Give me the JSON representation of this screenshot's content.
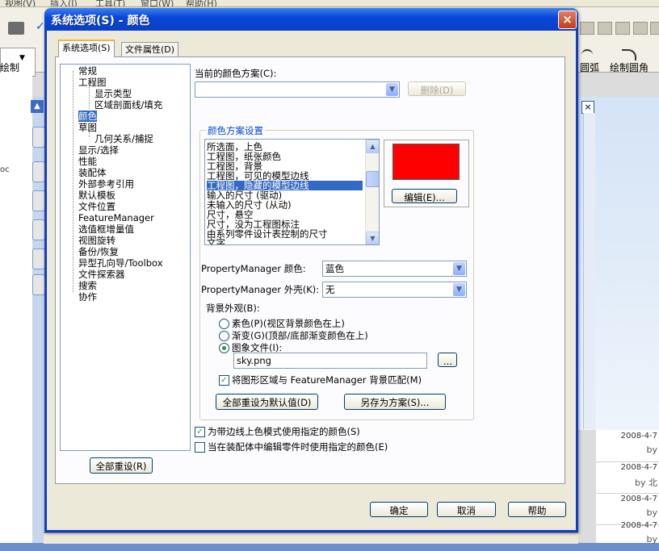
{
  "app": {
    "menu": [
      "视图(V)",
      "插入(I)",
      "工具(T)",
      "窗口(W)",
      "帮助(H)"
    ],
    "toolbar": {
      "draw_label": "绘制",
      "arc_label": "圆弧",
      "fillet_label": "绘制圆角"
    },
    "left_panel_label": "oc",
    "viewport_close": "×",
    "news": [
      {
        "date": "2008-4-7",
        "by": "by"
      },
      {
        "date": "2008-4-7",
        "by": "by 北"
      },
      {
        "date": "2008-4-7",
        "by": "by"
      },
      {
        "date": "2008-4-7",
        "by": "by"
      }
    ]
  },
  "dialog": {
    "title": "系统选项(S) - 颜色",
    "close_label": "×",
    "tabs": [
      {
        "label": "系统选项(S)",
        "active": true
      },
      {
        "label": "文件属性(D)",
        "active": false
      }
    ],
    "tree": {
      "items": [
        {
          "label": "常规",
          "level": 0,
          "selected": false
        },
        {
          "label": "工程图",
          "level": 0,
          "selected": false
        },
        {
          "label": "显示类型",
          "level": 1,
          "selected": false
        },
        {
          "label": "区域剖面线/填充",
          "level": 1,
          "selected": false
        },
        {
          "label": "颜色",
          "level": 0,
          "selected": true
        },
        {
          "label": "草图",
          "level": 0,
          "selected": false
        },
        {
          "label": "几何关系/捕捉",
          "level": 1,
          "selected": false
        },
        {
          "label": "显示/选择",
          "level": 0,
          "selected": false
        },
        {
          "label": "性能",
          "level": 0,
          "selected": false
        },
        {
          "label": "装配体",
          "level": 0,
          "selected": false
        },
        {
          "label": "外部参考引用",
          "level": 0,
          "selected": false
        },
        {
          "label": "默认模板",
          "level": 0,
          "selected": false
        },
        {
          "label": "文件位置",
          "level": 0,
          "selected": false
        },
        {
          "label": "FeatureManager",
          "level": 0,
          "selected": false
        },
        {
          "label": "选值框增量值",
          "level": 0,
          "selected": false
        },
        {
          "label": "视图旋转",
          "level": 0,
          "selected": false
        },
        {
          "label": "备份/恢复",
          "level": 0,
          "selected": false
        },
        {
          "label": "异型孔向导/Toolbox",
          "level": 0,
          "selected": false
        },
        {
          "label": "文件探索器",
          "level": 0,
          "selected": false
        },
        {
          "label": "搜索",
          "level": 0,
          "selected": false
        },
        {
          "label": "协作",
          "level": 0,
          "selected": false
        }
      ],
      "reset_all_label": "全部重设(R)"
    },
    "scheme": {
      "label": "当前的颜色方案(C):",
      "value": "",
      "delete_label": "删除(D)"
    },
    "scheme_settings": {
      "title": "颜色方案设置",
      "items": [
        {
          "label": "所选面，上色",
          "selected": false
        },
        {
          "label": "工程图，纸张颜色",
          "selected": false
        },
        {
          "label": "工程图，背景",
          "selected": false
        },
        {
          "label": "工程图，可见的模型边线",
          "selected": false
        },
        {
          "label": "工程图，隐藏的模型边线",
          "selected": true
        },
        {
          "label": "输入的尺寸 (驱动)",
          "selected": false
        },
        {
          "label": "未输入的尺寸 (从动)",
          "selected": false
        },
        {
          "label": "尺寸，悬空",
          "selected": false
        },
        {
          "label": "尺寸，没为工程图标注",
          "selected": false
        },
        {
          "label": "由系列零件设计表控制的尺寸",
          "selected": false
        },
        {
          "label": "文字",
          "selected": false
        }
      ],
      "swatch_color": "#ff0000",
      "edit_label": "编辑(E)..."
    },
    "pm_color": {
      "label": "PropertyManager 颜色:",
      "value": "蓝色"
    },
    "pm_skin": {
      "label": "PropertyManager 外壳(K):",
      "value": "无"
    },
    "background": {
      "label": "背景外观(B):",
      "options": [
        {
          "label": "素色(P)(视区背景颜色在上)",
          "checked": false
        },
        {
          "label": "渐变(G)(顶部/底部渐变颜色在上)",
          "checked": false
        },
        {
          "label": "图象文件(I):",
          "checked": true
        }
      ],
      "image_file": "sky.png",
      "browse_label": "...",
      "match_label": "将图形区域与 FeatureManager 背景匹配(M)",
      "match_checked": true
    },
    "reset_defaults_label": "全部重设为默认值(D)",
    "save_scheme_label": "另存为方案(S)...",
    "edge_color_label": "为带边线上色模式使用指定的颜色(S)",
    "edge_color_checked": true,
    "assembly_color_label": "当在装配体中编辑零件时使用指定的颜色(E)",
    "assembly_color_checked": false,
    "buttons": {
      "ok": "确定",
      "cancel": "取消",
      "help": "帮助"
    }
  }
}
